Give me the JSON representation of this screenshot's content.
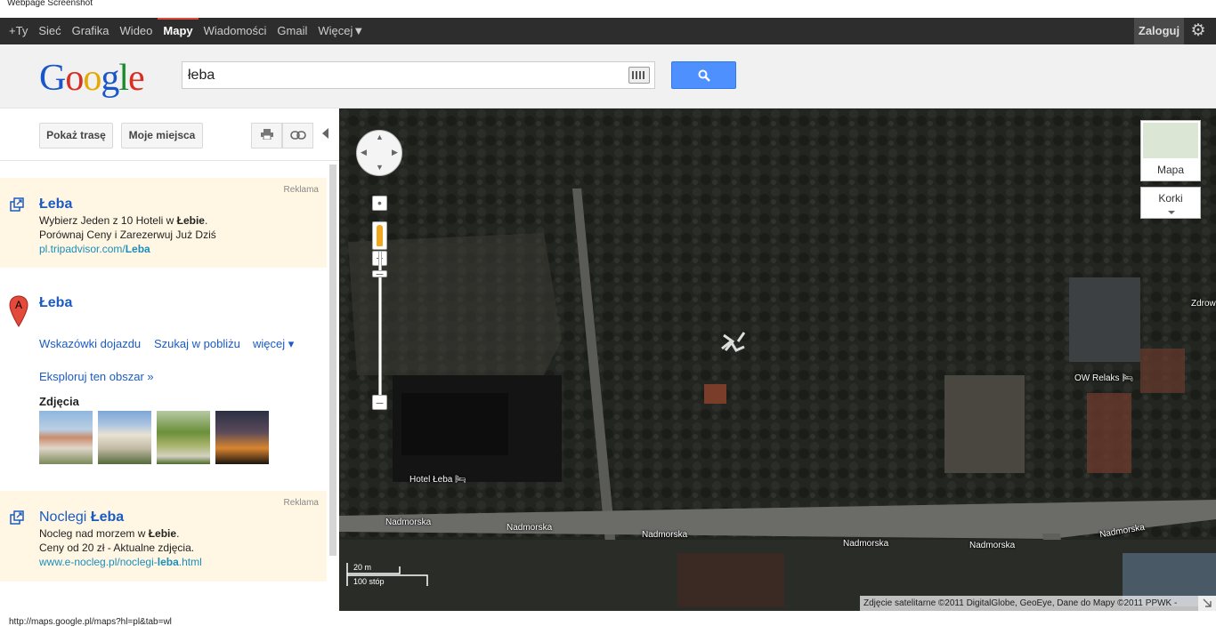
{
  "caption": "Webpage Screenshot",
  "topbar": {
    "nav": [
      "+Ty",
      "Sieć",
      "Grafika",
      "Wideo",
      "Mapy",
      "Wiadomości",
      "Gmail",
      "Więcej"
    ],
    "active": "Mapy",
    "login_label": "Zaloguj"
  },
  "header": {
    "logo": "Google",
    "search_value": "łeba"
  },
  "sidebar": {
    "route_button": "Pokaż trasę",
    "places_button": "Moje miejsca",
    "ad1": {
      "reklama": "Reklama",
      "title": "Łeba",
      "line1_pre": "Wybierz Jeden z 10 Hoteli w ",
      "line1_bold": "Łebie",
      "line1_post": ".",
      "line2": "Porównaj Ceny i Zarezerwuj Już Dziś",
      "url_pre": "pl.tripadvisor.com/",
      "url_bold": "Leba"
    },
    "place": {
      "marker": "A",
      "title": "Łeba",
      "directions": "Wskazówki dojazdu",
      "nearby": "Szukaj w pobliżu",
      "more": "więcej ▾",
      "explore": "Eksploruj ten obszar »",
      "photos_label": "Zdjęcia"
    },
    "ad2": {
      "reklama": "Reklama",
      "title_pre": "Noclegi ",
      "title_bold": "Łeba",
      "line1_pre": "Nocleg nad morzem w ",
      "line1_bold": "Łebie",
      "line1_post": ".",
      "line2": "Ceny od 20 zł - Aktualne zdjęcia.",
      "url_pre": "www.e-nocleg.pl/noclegi-",
      "url_bold": "leba",
      "url_post": ".html"
    }
  },
  "map": {
    "labels": {
      "hotel": "Hotel Łeba",
      "relaks": "OW Relaks",
      "zdrow": "Zdrow",
      "street": "Nadmorska"
    },
    "type_button": "Mapa",
    "traffic_button": "Korki",
    "scale_m": "20 m",
    "scale_ft": "100 stóp",
    "copyright": "Zdjęcie satelitarne ©2011 DigitalGlobe, GeoEye, Dane do Mapy ©2011 PPWK -"
  },
  "status_url": "http://maps.google.pl/maps?hl=pl&tab=wl"
}
